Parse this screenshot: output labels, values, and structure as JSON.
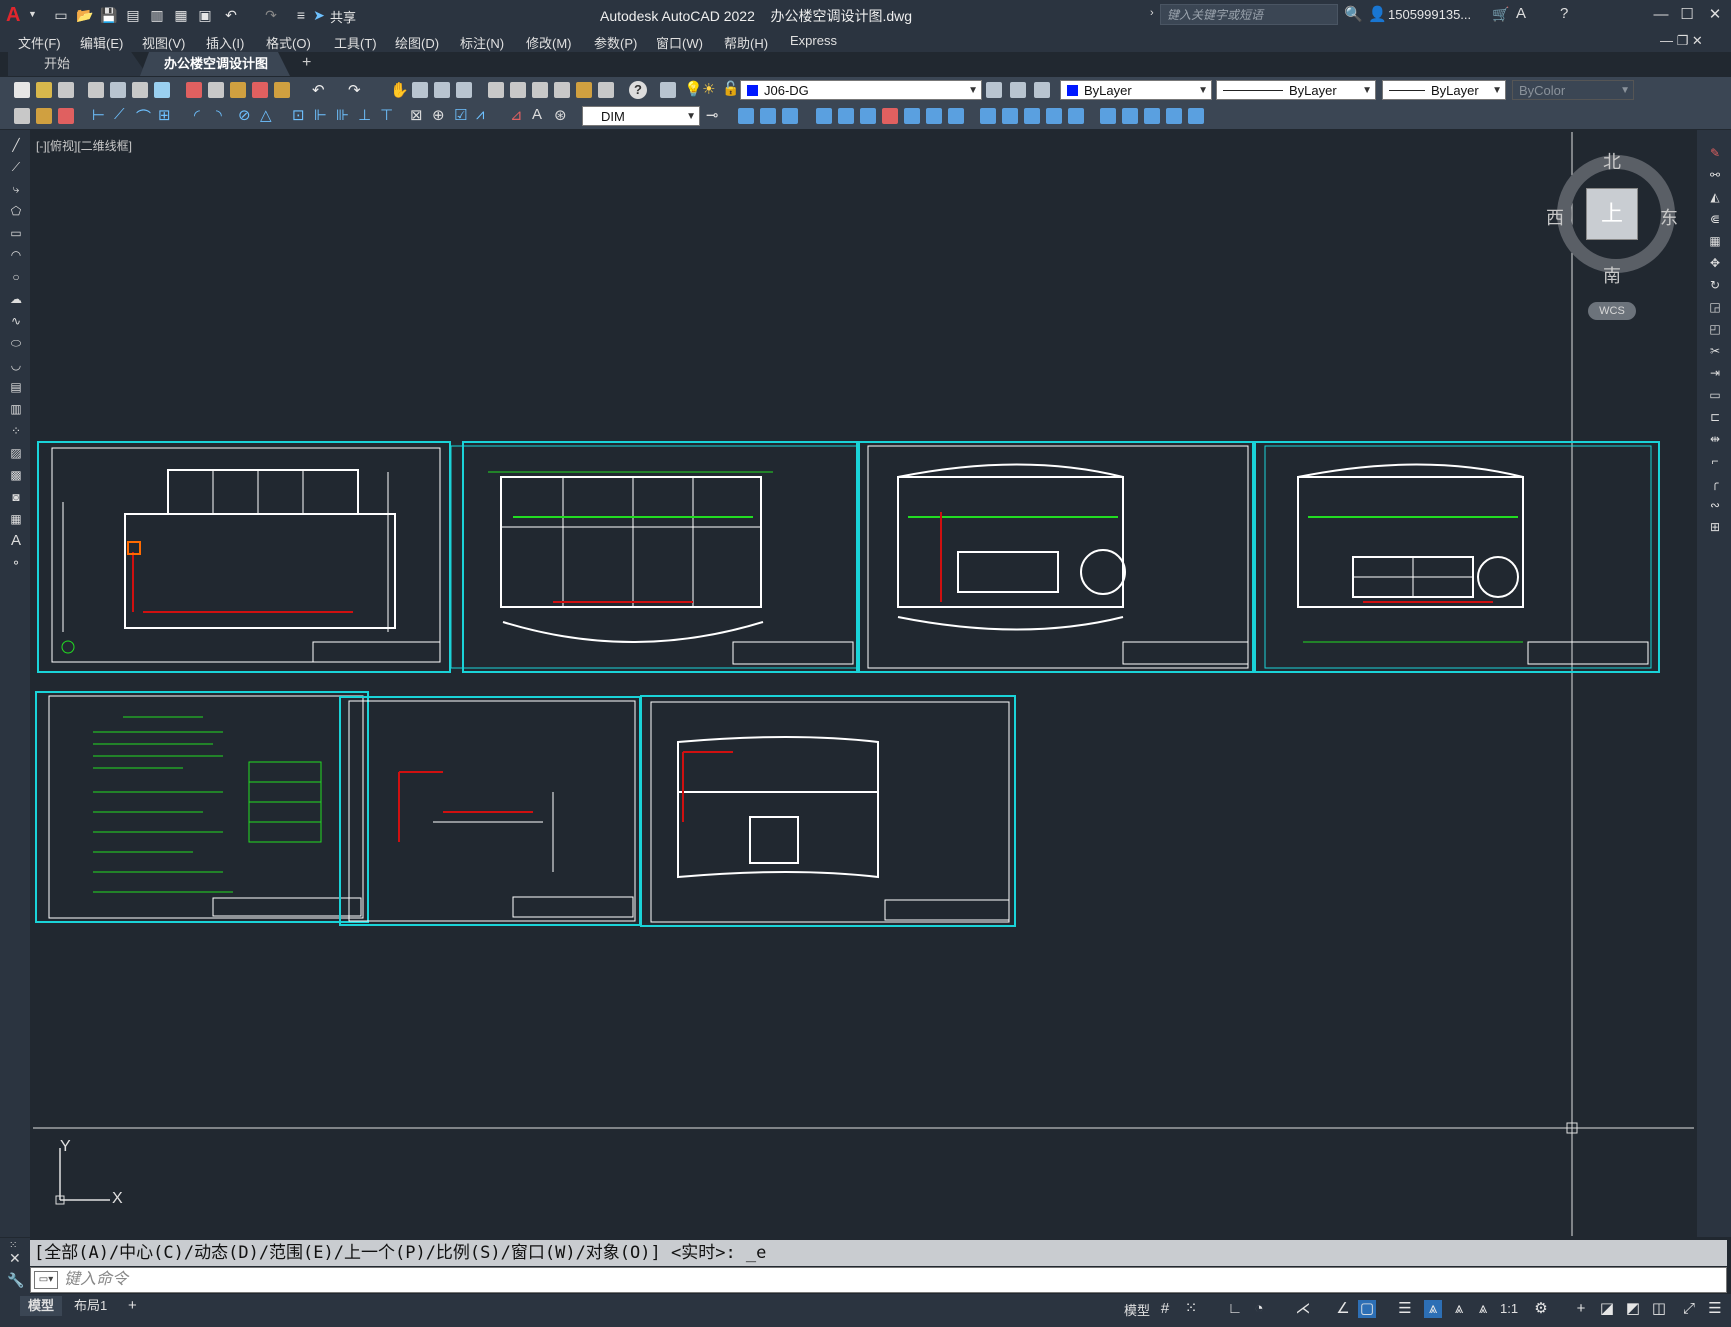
{
  "app": {
    "title": "Autodesk AutoCAD 2022    办公楼空调设计图.dwg",
    "logo": "A",
    "search_placeholder": "键入关键字或短语",
    "user": "1505999135...",
    "share_label": "共享"
  },
  "menu": [
    "文件(F)",
    "编辑(E)",
    "视图(V)",
    "插入(I)",
    "格式(O)",
    "工具(T)",
    "绘图(D)",
    "标注(N)",
    "修改(M)",
    "参数(P)",
    "窗口(W)",
    "帮助(H)",
    "Express"
  ],
  "tabs": {
    "start": "开始",
    "doc": "办公楼空调设计图*"
  },
  "toolbar": {
    "layer": "J06-DG",
    "color": "ByLayer",
    "linetype": "ByLayer",
    "lineweight": "ByLayer",
    "plotstyle": "ByColor",
    "dimstyle": "DIM"
  },
  "viewport_label": "[-][俯视][二维线框]",
  "viewcube": {
    "face": "上",
    "north": "北",
    "south": "南",
    "east": "东",
    "west": "西",
    "wcs": "WCS"
  },
  "ucs": {
    "x": "X",
    "y": "Y"
  },
  "command": {
    "history": "[全部(A)/中心(C)/动态(D)/范围(E)/上一个(P)/比例(S)/窗口(W)/对象(O)] <实时>: _e",
    "placeholder": "键入命令"
  },
  "layout_tabs": [
    "模型",
    "布局1"
  ],
  "status": {
    "model": "模型",
    "scale": "1:1"
  },
  "colors": {
    "accent_cyan": "#1ad3d8",
    "bg": "#212830",
    "chrome": "#2b3440"
  }
}
